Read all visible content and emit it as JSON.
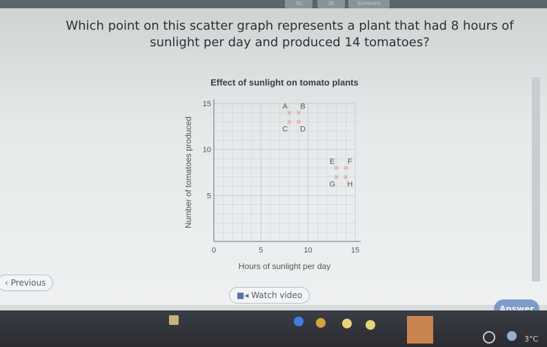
{
  "tabs": [
    "3D",
    "3E",
    "Summary"
  ],
  "question": "Which point on this scatter graph represents a plant that had 8 hours of sunlight per day and produced 14 tomatoes?",
  "nav": {
    "previous": "Previous",
    "watch_video": "Watch video",
    "answer": "Answer"
  },
  "taskbar": {
    "temperature": "3°C"
  },
  "chart_data": {
    "type": "scatter",
    "title": "Effect of sunlight on tomato plants",
    "xlabel": "Hours of sunlight per day",
    "ylabel": "Number of tomatoes produced",
    "xlim": [
      0,
      15
    ],
    "ylim": [
      0,
      15
    ],
    "xticks": [
      "0",
      "5",
      "10",
      "15"
    ],
    "yticks": [
      "5",
      "10",
      "15"
    ],
    "grid": true,
    "marker": "cross",
    "points": [
      {
        "label": "A",
        "x": 8,
        "y": 14
      },
      {
        "label": "B",
        "x": 9,
        "y": 14
      },
      {
        "label": "C",
        "x": 8,
        "y": 13
      },
      {
        "label": "D",
        "x": 9,
        "y": 13
      },
      {
        "label": "E",
        "x": 13,
        "y": 8
      },
      {
        "label": "F",
        "x": 14,
        "y": 8
      },
      {
        "label": "G",
        "x": 13,
        "y": 7
      },
      {
        "label": "H",
        "x": 14,
        "y": 7
      }
    ],
    "colors": {
      "marker": "#e0a0a8",
      "grid": "#c9cdd1",
      "axis": "#6b6f74"
    }
  }
}
